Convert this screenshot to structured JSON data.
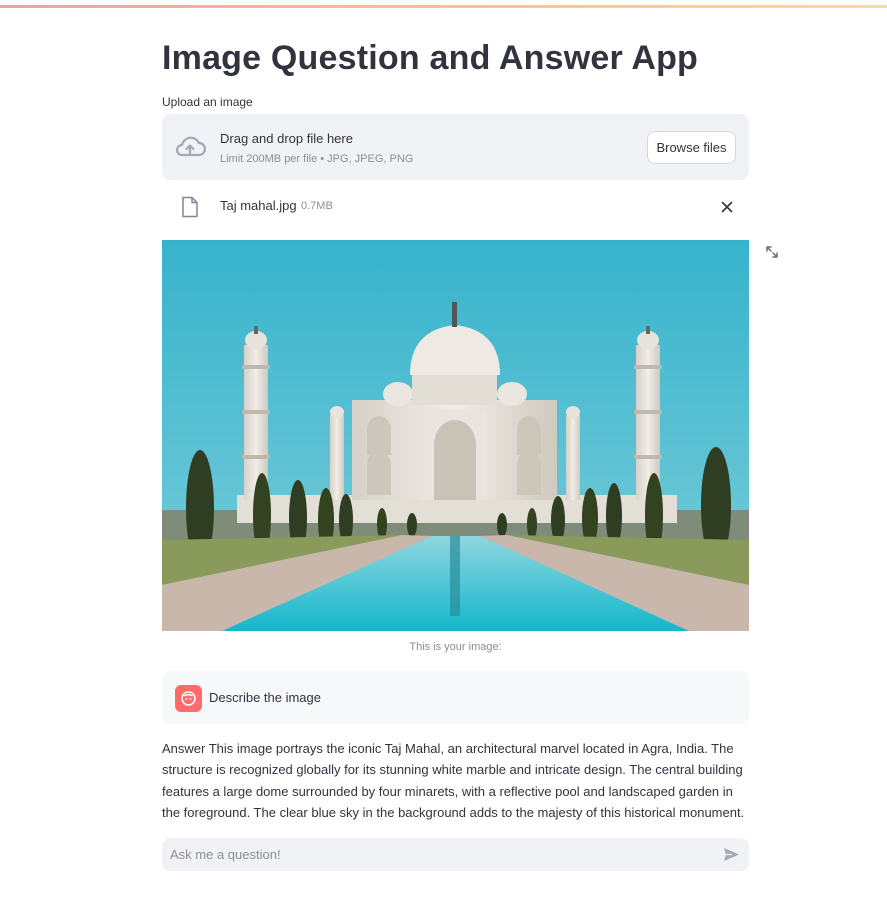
{
  "app": {
    "title": "Image Question and Answer App"
  },
  "uploader": {
    "label": "Upload an image",
    "drop_text": "Drag and drop file here",
    "limit_text": "Limit 200MB per file • JPG, JPEG, PNG",
    "browse_label": "Browse files",
    "upload_icon": "cloud-upload-icon"
  },
  "file": {
    "name": "Taj mahal.jpg",
    "size": "0.7MB",
    "file_icon": "file-icon",
    "remove_icon": "close-icon"
  },
  "image": {
    "caption": "This is your image:",
    "fullscreen_icon": "fullscreen-icon"
  },
  "chat": {
    "user_message": "Describe the image",
    "avatar_icon": "user-avatar-icon",
    "answer": "Answer This image portrays the iconic Taj Mahal, an architectural marvel located in Agra, India. The structure is recognized globally for its stunning white marble and intricate design. The central building features a large dome surrounded by four minarets, with a reflective pool and landscaped garden in the foreground. The clear blue sky in the background adds to the majesty of this historical monument."
  },
  "input": {
    "placeholder": "Ask me a question!",
    "value": "",
    "send_icon": "send-icon"
  },
  "colors": {
    "accent": "#ff4b4b",
    "accent_secondary": "#ffbd45",
    "panel_bg": "#f0f2f6",
    "text": "#31333f",
    "muted_text": "#8b8d96",
    "avatar_bg": "#ff6b6b"
  }
}
